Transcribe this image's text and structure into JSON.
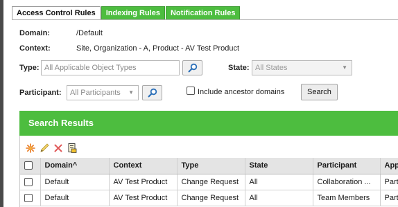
{
  "tabs": [
    {
      "label": "Access Control Rules",
      "active": true
    },
    {
      "label": "Indexing Rules",
      "active": false
    },
    {
      "label": "Notification Rules",
      "active": false
    }
  ],
  "domain": {
    "label": "Domain:",
    "value": "/Default"
  },
  "context": {
    "label": "Context:",
    "value_prefix": "Site, Organization - A",
    "value_suffix": ", Product - AV Test Product"
  },
  "type_filter": {
    "label": "Type:",
    "value": "All Applicable Object Types"
  },
  "state_filter": {
    "label": "State:",
    "value": "All States"
  },
  "participant_filter": {
    "label": "Participant:",
    "value": "All Participants"
  },
  "include_ancestor": {
    "label": "Include ancestor domains",
    "checked": false
  },
  "search_button": {
    "label": "Search"
  },
  "results": {
    "title": "Search Results",
    "toolbar_icons": [
      "new-rule-icon",
      "edit-icon",
      "delete-icon",
      "export-icon"
    ],
    "columns": [
      "Domain^",
      "Context",
      "Type",
      "State",
      "Participant",
      "App"
    ],
    "rows": [
      [
        "Default",
        "AV Test Product",
        "Change Request",
        "All",
        "Collaboration ...",
        "Part"
      ],
      [
        "Default",
        "AV Test Product",
        "Change Request",
        "All",
        "Team Members",
        "Part"
      ]
    ]
  },
  "colors": {
    "accent_green": "#4dbd3f"
  }
}
